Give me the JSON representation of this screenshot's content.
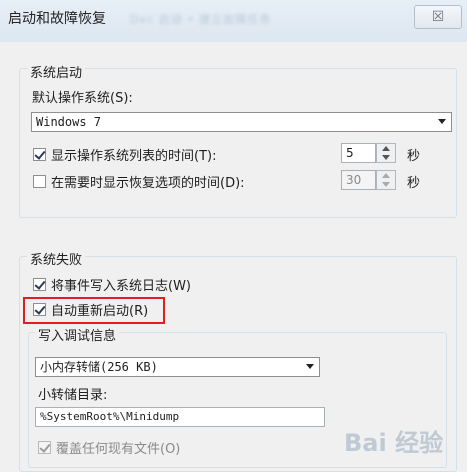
{
  "window": {
    "title": "启动和故障恢复",
    "blurred_title": "Dec 启动 • 建立故障任务",
    "close_glyph": "☒"
  },
  "startup": {
    "group_label": "系统启动",
    "default_os_label": "默认操作系统(S):",
    "default_os_value": "Windows 7",
    "show_os_list": {
      "checked": true,
      "label": "显示操作系统列表的时间(T):",
      "value": "5",
      "unit": "秒"
    },
    "show_recovery": {
      "checked": false,
      "label": "在需要时显示恢复选项的时间(D):",
      "value": "30",
      "unit": "秒"
    }
  },
  "failure": {
    "group_label": "系统失败",
    "write_event": {
      "checked": true,
      "label": "将事件写入系统日志(W)"
    },
    "auto_restart": {
      "checked": true,
      "label": "自动重新启动(R)"
    },
    "debug": {
      "group_label": "写入调试信息",
      "type_value": "小内存转储(256 KB)",
      "dir_label": "小转储目录:",
      "dir_value": "%SystemRoot%\\Minidump",
      "overwrite": {
        "checked": true,
        "label": "覆盖任何现有文件(O)"
      }
    }
  },
  "watermark": "Bai 经验"
}
